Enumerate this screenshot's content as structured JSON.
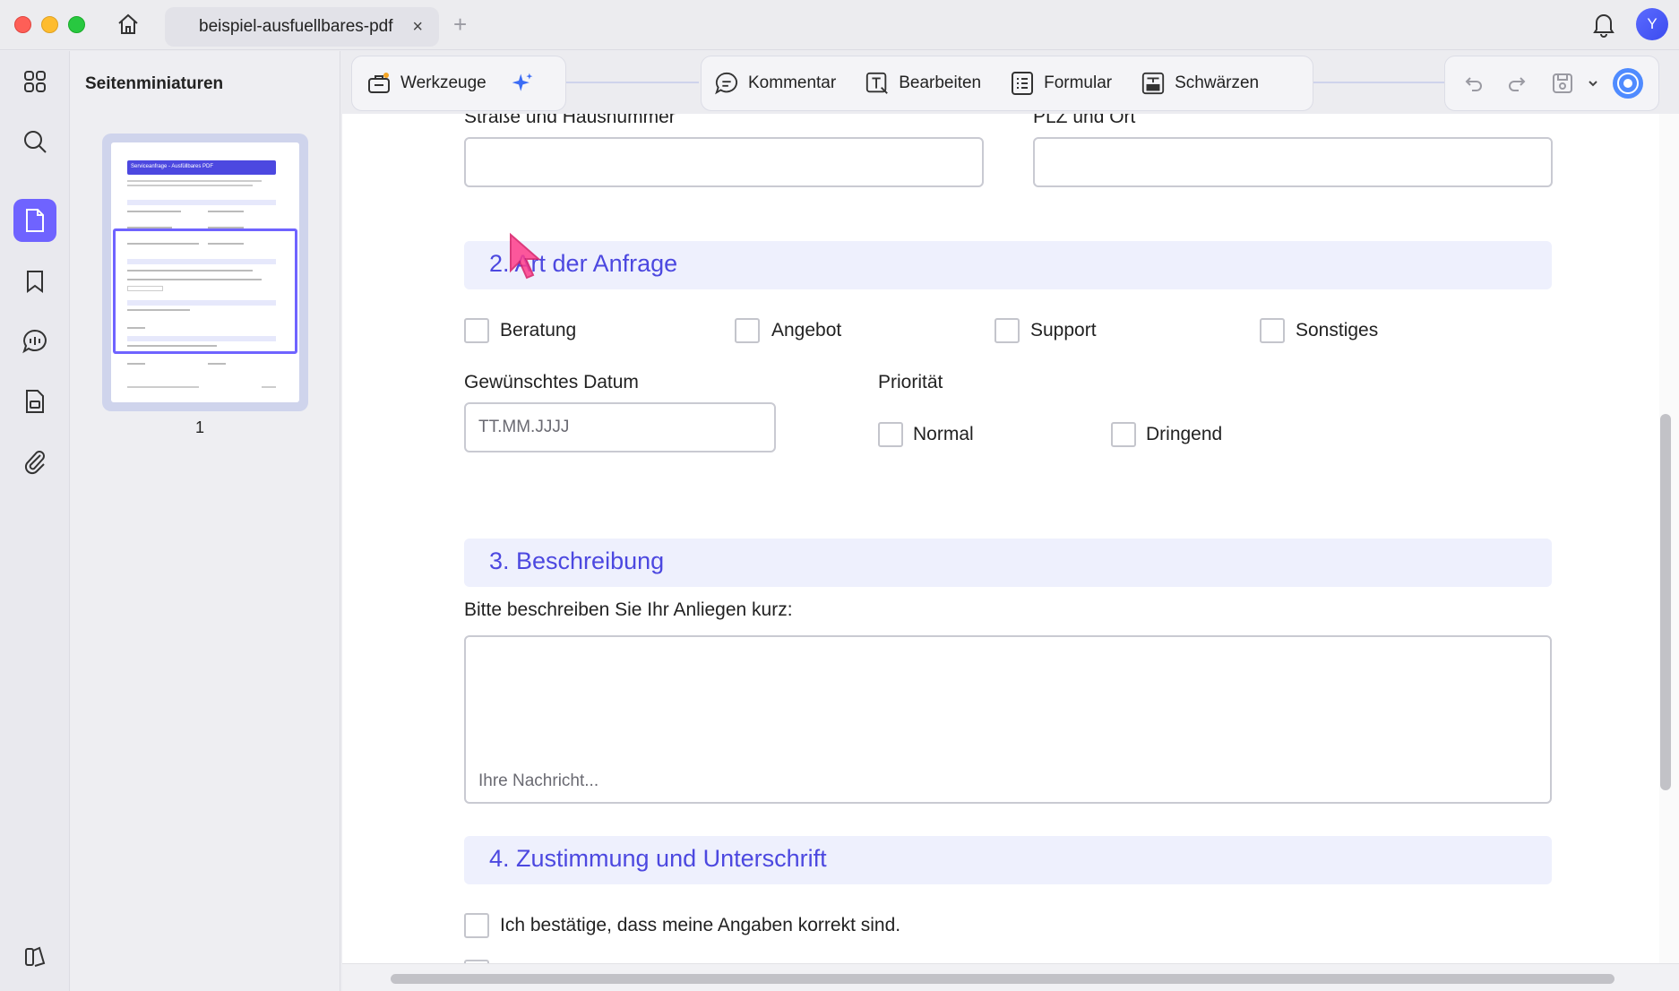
{
  "window": {
    "tab_title": "beispiel-ausfuellbares-pdf",
    "tab_close": "×",
    "tab_add": "+",
    "avatar_initial": "Y"
  },
  "sidebar": {
    "title": "Seitenminiaturen",
    "page_number": "1",
    "rail_icons": [
      "apps-grid-icon",
      "search-icon",
      "pages-icon",
      "bookmark-icon",
      "comments-icon",
      "document-icon",
      "attachment-icon",
      "layers-icon"
    ]
  },
  "toolbar": {
    "tools_label": "Werkzeuge",
    "comment_label": "Kommentar",
    "edit_label": "Bearbeiten",
    "form_label": "Formular",
    "redact_label": "Schwärzen"
  },
  "form": {
    "street_label": "Straße und Hausnummer",
    "zip_city_label": "PLZ und Ort",
    "section2_title": "2. Art der Anfrage",
    "request_types": [
      "Beratung",
      "Angebot",
      "Support",
      "Sonstiges"
    ],
    "date_label": "Gewünschtes Datum",
    "date_placeholder": "TT.MM.JJJJ",
    "priority_label": "Priorität",
    "priorities": [
      "Normal",
      "Dringend"
    ],
    "section3_title": "3. Beschreibung",
    "description_label": "Bitte beschreiben Sie Ihr Anliegen kurz:",
    "message_placeholder": "Ihre Nachricht...",
    "section4_title": "4. Zustimmung und Unterschrift",
    "consent_label": "Ich bestätige, dass meine Angaben korrekt sind."
  },
  "thumbnail": {
    "header_title": "Serviceanfrage - Ausfüllbares PDF"
  },
  "colors": {
    "accent": "#6f63ff",
    "section_text": "#4c48e0",
    "section_bg": "#eef0fd"
  }
}
